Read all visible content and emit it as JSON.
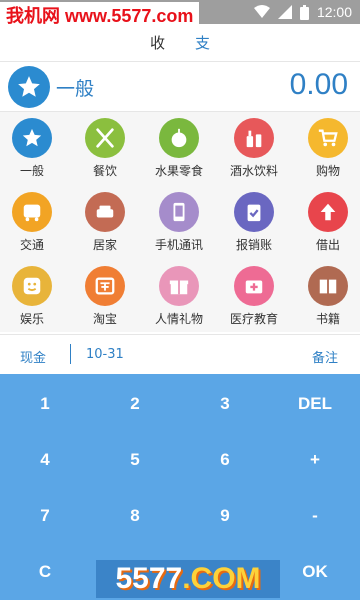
{
  "watermark_top": "我机网 www.5577.com",
  "status": {
    "time": "12:00"
  },
  "tabs": [
    {
      "label": "收"
    },
    {
      "label": "支"
    }
  ],
  "summary": {
    "category": "一般",
    "amount": "0.00"
  },
  "categories": [
    {
      "label": "一般",
      "color": "#2b8bd0",
      "icon": "star-icon"
    },
    {
      "label": "餐饮",
      "color": "#8bbf3e",
      "icon": "fork-knife-icon"
    },
    {
      "label": "水果零食",
      "color": "#7ab83e",
      "icon": "apple-icon"
    },
    {
      "label": "酒水饮料",
      "color": "#e7585a",
      "icon": "bottle-icon"
    },
    {
      "label": "购物",
      "color": "#f5b82e",
      "icon": "cart-icon"
    },
    {
      "label": "交通",
      "color": "#f2a424",
      "icon": "bus-icon"
    },
    {
      "label": "居家",
      "color": "#c36b54",
      "icon": "sofa-icon"
    },
    {
      "label": "手机通讯",
      "color": "#a58ccb",
      "icon": "phone-icon"
    },
    {
      "label": "报销账",
      "color": "#6a67c1",
      "icon": "clipboard-icon"
    },
    {
      "label": "借出",
      "color": "#e8454c",
      "icon": "arrow-up-icon"
    },
    {
      "label": "娱乐",
      "color": "#e8b43a",
      "icon": "smile-icon"
    },
    {
      "label": "淘宝",
      "color": "#f07e34",
      "icon": "taobao-icon"
    },
    {
      "label": "人情礼物",
      "color": "#e996b9",
      "icon": "gift-icon"
    },
    {
      "label": "医疗教育",
      "color": "#ee6b94",
      "icon": "medkit-icon"
    },
    {
      "label": "书籍",
      "color": "#b06a52",
      "icon": "book-icon"
    }
  ],
  "note_row": {
    "account": "现金",
    "date": "10-31",
    "note": "备注"
  },
  "keypad": {
    "keys": [
      "1",
      "2",
      "3",
      "DEL",
      "4",
      "5",
      "6",
      "+",
      "7",
      "8",
      "9",
      "-",
      "C",
      "0",
      ".",
      "OK"
    ]
  },
  "watermark_bottom": {
    "prefix": "5577",
    "suffix": ".COM"
  }
}
